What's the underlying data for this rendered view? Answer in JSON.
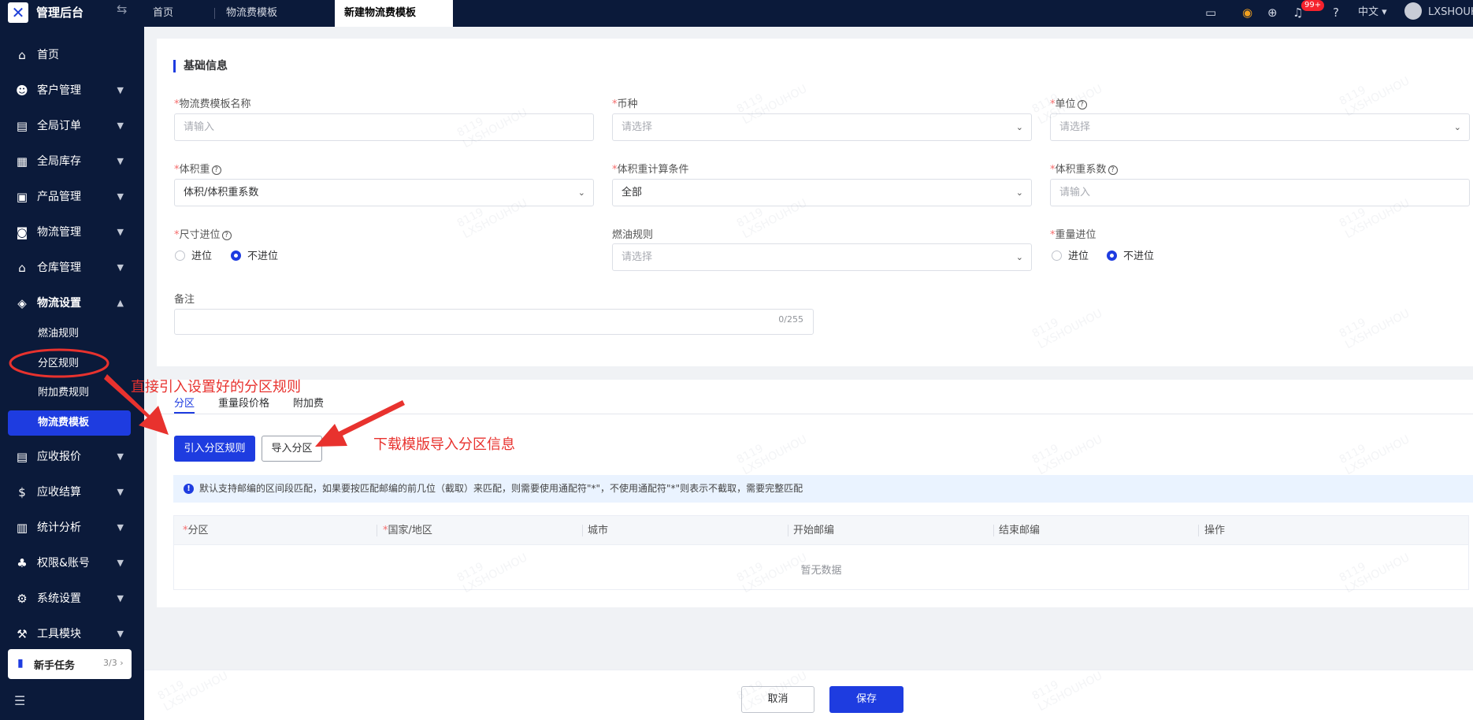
{
  "topbar": {
    "app_title": "管理后台",
    "tabs": [
      {
        "label": "首页"
      },
      {
        "label": "物流费模板"
      },
      {
        "label": "新建物流费模板"
      }
    ],
    "notification_badge": "99+",
    "language": "中文",
    "username": "LXSHOUH"
  },
  "sidebar": {
    "items": [
      {
        "label": "首页",
        "icon": "home-icon"
      },
      {
        "label": "客户管理",
        "icon": "users-icon"
      },
      {
        "label": "全局订单",
        "icon": "orders-icon"
      },
      {
        "label": "全局库存",
        "icon": "inventory-icon"
      },
      {
        "label": "产品管理",
        "icon": "product-icon"
      },
      {
        "label": "物流管理",
        "icon": "truck-icon"
      },
      {
        "label": "仓库管理",
        "icon": "warehouse-icon"
      },
      {
        "label": "物流设置",
        "icon": "logistics-settings-icon"
      },
      {
        "label": "应收报价",
        "icon": "quote-icon"
      },
      {
        "label": "应收结算",
        "icon": "settlement-icon"
      },
      {
        "label": "统计分析",
        "icon": "chart-icon"
      },
      {
        "label": "权限&账号",
        "icon": "org-icon"
      },
      {
        "label": "系统设置",
        "icon": "settings-icon"
      },
      {
        "label": "工具模块",
        "icon": "tool-icon"
      }
    ],
    "sub_items": [
      {
        "label": "燃油规则"
      },
      {
        "label": "分区规则"
      },
      {
        "label": "附加费规则"
      },
      {
        "label": "物流费模板"
      }
    ],
    "task_card": {
      "label": "新手任务",
      "count": "3/3"
    }
  },
  "form": {
    "section_title": "基础信息",
    "template_name": {
      "label": "物流费模板名称",
      "placeholder": "请输入"
    },
    "currency": {
      "label": "币种",
      "placeholder": "请选择"
    },
    "unit": {
      "label": "单位",
      "placeholder": "请选择"
    },
    "volume_weight": {
      "label": "体积重",
      "value": "体积/体积重系数"
    },
    "volume_condition": {
      "label": "体积重计算条件",
      "value": "全部"
    },
    "volume_coefficient": {
      "label": "体积重系数",
      "placeholder": "请输入"
    },
    "size_rounding": {
      "label": "尺寸进位",
      "options": [
        "进位",
        "不进位"
      ],
      "selected": "不进位"
    },
    "fuel_rule": {
      "label": "燃油规则",
      "placeholder": "请选择"
    },
    "weight_rounding": {
      "label": "重量进位",
      "options": [
        "进位",
        "不进位"
      ],
      "selected": "不进位"
    },
    "remark": {
      "label": "备注",
      "counter": "0/255"
    }
  },
  "zone_section": {
    "tabs": [
      "分区",
      "重量段价格",
      "附加费"
    ],
    "active_tab": "分区",
    "import_rule_button": "引入分区规则",
    "import_zone_button": "导入分区",
    "info_text": "默认支持邮编的区间段匹配，如果要按匹配邮编的前几位（截取）来匹配，则需要使用通配符\"*\"，不使用通配符\"*\"则表示不截取，需要完整匹配",
    "columns": [
      "分区",
      "国家/地区",
      "城市",
      "开始邮编",
      "结束邮编",
      "操作"
    ],
    "empty_text": "暂无数据"
  },
  "footer": {
    "cancel": "取消",
    "save": "保存"
  },
  "annotations": {
    "left": "直接引入设置好的分区规则",
    "right": "下载模版导入分区信息"
  },
  "watermark": {
    "line1": "8119",
    "line2": "LXSHOUHOU"
  },
  "colors": {
    "primary": "#1e3ce0",
    "sidebar_bg": "#0b1a3a",
    "annotation": "#e8322e"
  }
}
